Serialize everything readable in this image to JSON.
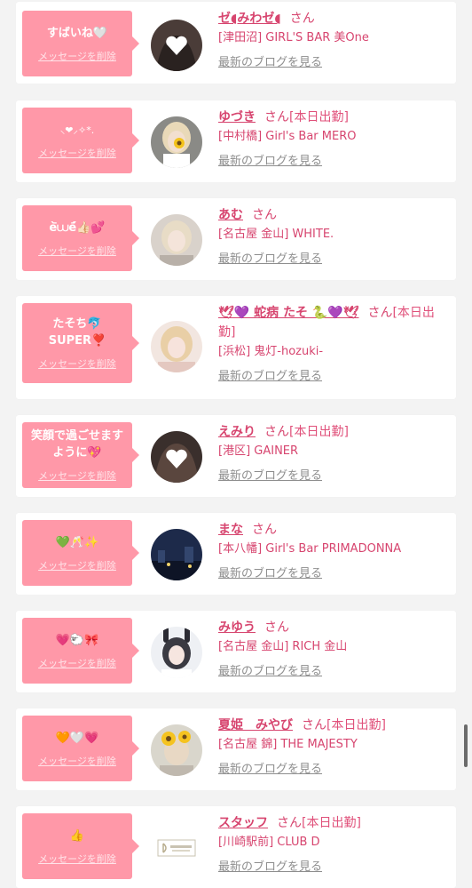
{
  "delete_label": "メッセージを削除",
  "blog_label": "最新のブログを見る",
  "san_label": "さん",
  "colors": {
    "bubble": "#ff98a8",
    "name": "#d7456f",
    "link_gray": "#8e8e8e"
  },
  "items": [
    {
      "message": "すばいね🤍",
      "name": "ゼ◖みわゼ◖",
      "suffix": "",
      "shop": "[津田沼] GIRL'S BAR 美One",
      "avatar": "heart-avatar-icon"
    },
    {
      "message": "⸜❤︎⸝‍✧*.",
      "name": "ゆづき",
      "suffix": "[本日出勤]",
      "shop": "[中村橋] Girl's Bar MERO",
      "avatar": "sunflower-avatar-icon"
    },
    {
      "message": "è᷅⩊é᷄👍🏻💕",
      "name": "あむ",
      "suffix": "",
      "shop": "[名古屋 金山] WHITE.",
      "avatar": "girl-avatar-icon"
    },
    {
      "message": "たそち🐬\nSUPER❣️",
      "name": "🕊💜 蛇病 たそ 🐍💜🕊",
      "suffix": "[本日出勤]",
      "shop": "[浜松] 鬼灯-hozuki-",
      "avatar": "girl-avatar-icon"
    },
    {
      "message": "笑顔で過ごせます\nように💖",
      "name": "えみり",
      "suffix": "[本日出勤]",
      "shop": "[港区] GAINER",
      "avatar": "heart-avatar-icon"
    },
    {
      "message": "💚🥂✨",
      "name": "まな",
      "suffix": "",
      "shop": "[本八幡] Girl's Bar PRIMADONNA",
      "avatar": "city-night-avatar-icon"
    },
    {
      "message": "💗🐑🎀",
      "name": "みゆう",
      "suffix": "",
      "shop": "[名古屋 金山] RICH 金山",
      "avatar": "bunny-girl-avatar-icon"
    },
    {
      "message": "🧡🤍💗",
      "name": "夏姫　みやび",
      "suffix": "[本日出勤]",
      "shop": "[名古屋 錦] THE MAJESTY",
      "avatar": "sunflower-avatar-icon"
    },
    {
      "message": "👍",
      "name": "スタッフ",
      "suffix": "[本日出勤]",
      "shop": "[川崎駅前] CLUB D",
      "avatar": "club-d-logo-icon"
    }
  ]
}
